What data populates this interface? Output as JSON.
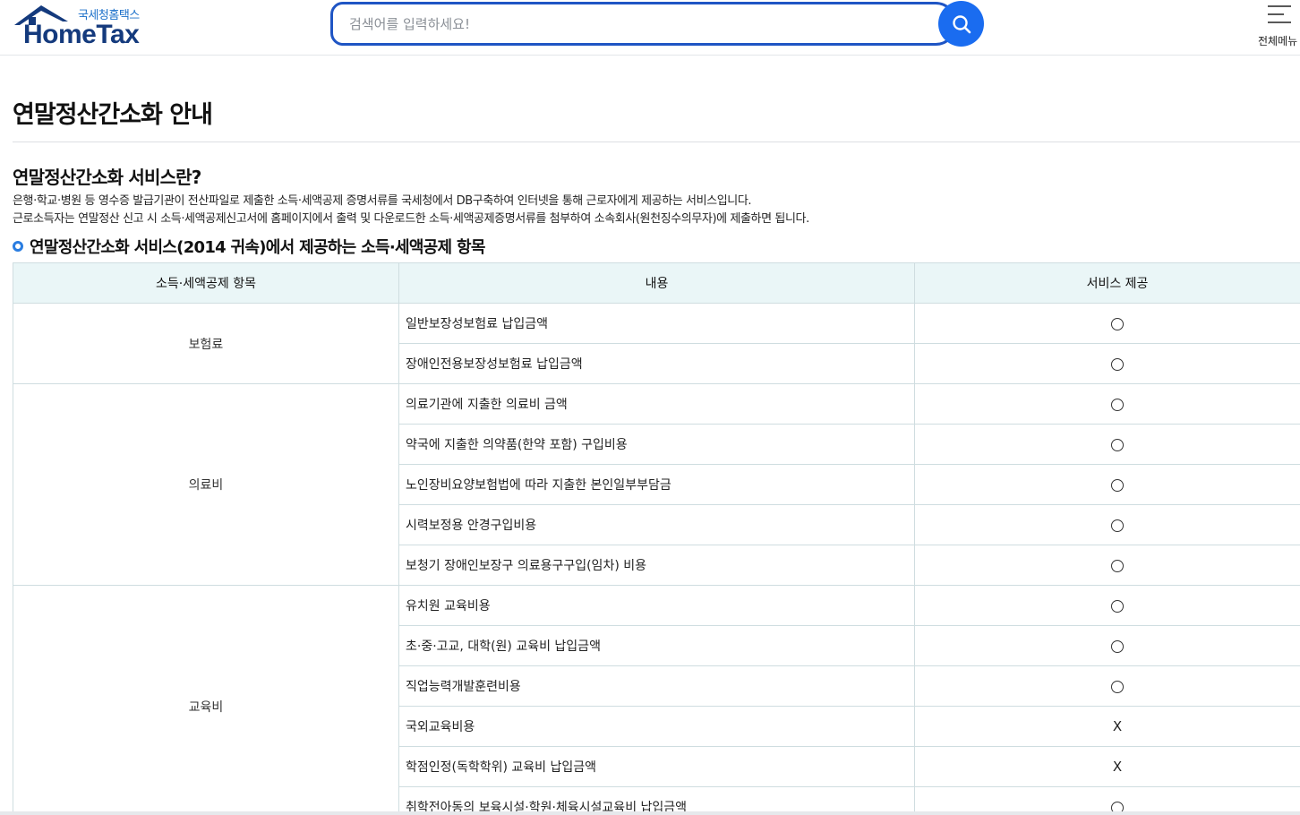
{
  "header": {
    "logo_sub": "국세청홈택스",
    "logo_main": "HomeTax",
    "search_placeholder": "검색어를 입력하세요!",
    "menu_label": "전체메뉴"
  },
  "page": {
    "title": "연말정산간소화 안내",
    "section_title": "연말정산간소화 서비스란?",
    "desc1": "은행·학교·병원 등 영수증 발급기관이 전산파일로 제출한 소득·세액공제 증명서류를 국세청에서 DB구축하여 인터넷을 통해 근로자에게 제공하는 서비스입니다.",
    "desc2": "근로소득자는 연말정산 신고 시 소득·세액공제신고서에 홈페이지에서 출력 및 다운로드한 소득·세액공제증명서류를 첨부하여 소속회사(원천징수의무자)에 제출하면 됩니다.",
    "sub_title": "연말정산간소화 서비스(2014 귀속)에서 제공하는 소득·세액공제 항목"
  },
  "table": {
    "headers": [
      "소득·세액공제 항목",
      "내용",
      "서비스 제공"
    ],
    "groups": [
      {
        "category": "보험료",
        "rows": [
          {
            "item": "일반보장성보험료 납입금액",
            "service": "O"
          },
          {
            "item": "장애인전용보장성보험료 납입금액",
            "service": "O"
          }
        ]
      },
      {
        "category": "의료비",
        "rows": [
          {
            "item": "의료기관에 지출한 의료비 금액",
            "service": "O"
          },
          {
            "item": "약국에 지출한 의약품(한약 포함) 구입비용",
            "service": "O"
          },
          {
            "item": "노인장비요양보험법에 따라 지출한 본인일부부담금",
            "service": "O"
          },
          {
            "item": "시력보정용 안경구입비용",
            "service": "O"
          },
          {
            "item": "보청기 장애인보장구 의료용구구입(임차) 비용",
            "service": "O"
          }
        ]
      },
      {
        "category": "교육비",
        "rows": [
          {
            "item": "유치원 교육비용",
            "service": "O"
          },
          {
            "item": "초·중·고교, 대학(원) 교육비 납입금액",
            "service": "O"
          },
          {
            "item": "직업능력개발훈련비용",
            "service": "O"
          },
          {
            "item": "국외교육비용",
            "service": "X"
          },
          {
            "item": "학점인정(독학학위) 교육비 납입금액",
            "service": "X"
          },
          {
            "item": "취학전아동의 보육시설·학원·체육시설교육비 납입금액",
            "service": "O"
          }
        ]
      }
    ]
  }
}
